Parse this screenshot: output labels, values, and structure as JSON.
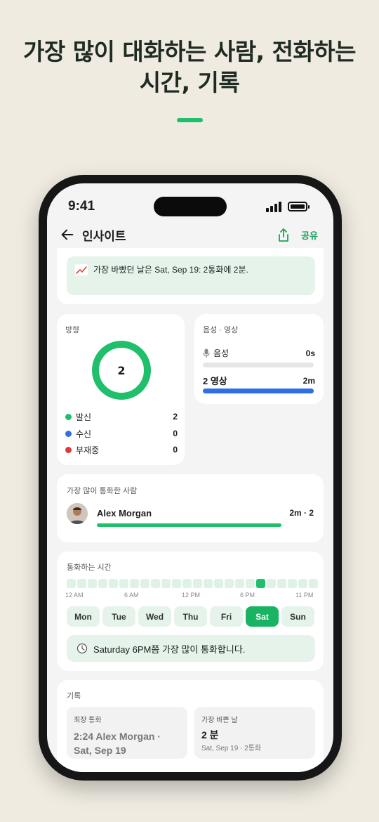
{
  "headline": {
    "line1": "가장 많이 대화하는 사람, 전화하는",
    "line2": "시간, 기록"
  },
  "colors": {
    "accent": "#1fbf6c",
    "blue": "#2f6fe4",
    "red": "#d93a3a",
    "tint": "#e5f3ea"
  },
  "status_bar": {
    "time": "9:41"
  },
  "navbar": {
    "back_icon": "arrow-left-icon",
    "title": "인사이트",
    "share_icon": "share-icon",
    "share_label": "공유"
  },
  "busiest": {
    "icon": "trend-up-icon",
    "text": "가장 바빴던 날은 Sat, Sep 19: 2통화에 2분."
  },
  "direction": {
    "label": "방향",
    "total": "2",
    "legend": [
      {
        "label": "발신",
        "count": "2",
        "color": "#1fbf6c"
      },
      {
        "label": "수신",
        "count": "0",
        "color": "#2f6fe4"
      },
      {
        "label": "부재중",
        "count": "0",
        "color": "#d93a3a"
      }
    ]
  },
  "media": {
    "label": "음성 · 영상",
    "voice": {
      "icon": "microphone-icon",
      "label": "음성",
      "value": "0s",
      "fraction": 0
    },
    "video": {
      "label": "2 영상",
      "value": "2m",
      "fraction": 1
    }
  },
  "top_contact": {
    "label": "가장 많이 통화한 사람",
    "name": "Alex Morgan",
    "stat": "2m · 2",
    "fraction": 1
  },
  "call_hours": {
    "label": "통화하는 시간",
    "peak_hour_index": 18,
    "hour_labels": [
      "12 AM",
      "6 AM",
      "12 PM",
      "6 PM",
      "11 PM"
    ],
    "days": [
      "Mon",
      "Tue",
      "Wed",
      "Thu",
      "Fri",
      "Sat",
      "Sun"
    ],
    "active_day": "Sat",
    "peak_icon": "clock-icon",
    "peak_text": "Saturday 6PM쯤 가장 많이 통화합니다."
  },
  "records": {
    "label": "기록",
    "longest": {
      "label": "최장 통화",
      "value": "2:24 Alex Morgan · Sat, Sep 19"
    },
    "busiest_day": {
      "label": "가장 바쁜 날",
      "value": "2 분",
      "sub": "Sat, Sep 19 · 2통화"
    }
  }
}
